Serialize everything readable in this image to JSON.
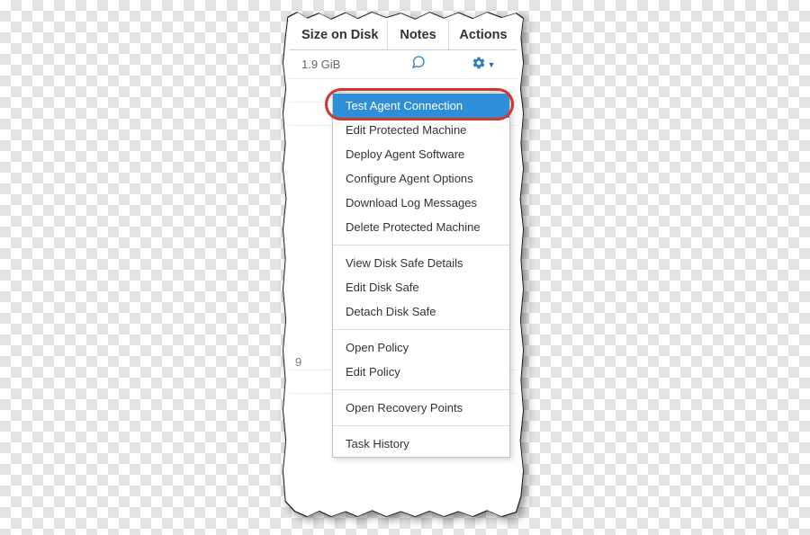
{
  "table": {
    "headers": {
      "size": "Size on Disk",
      "notes": "Notes",
      "actions": "Actions"
    },
    "row": {
      "size": "1.9 GiB"
    },
    "stray_char": "9"
  },
  "menu": {
    "groups": [
      [
        "Test Agent Connection",
        "Edit Protected Machine",
        "Deploy Agent Software",
        "Configure Agent Options",
        "Download Log Messages",
        "Delete Protected Machine"
      ],
      [
        "View Disk Safe Details",
        "Edit Disk Safe",
        "Detach Disk Safe"
      ],
      [
        "Open Policy",
        "Edit Policy"
      ],
      [
        "Open Recovery Points"
      ],
      [
        "Task History"
      ]
    ],
    "selected": "Test Agent Connection"
  }
}
